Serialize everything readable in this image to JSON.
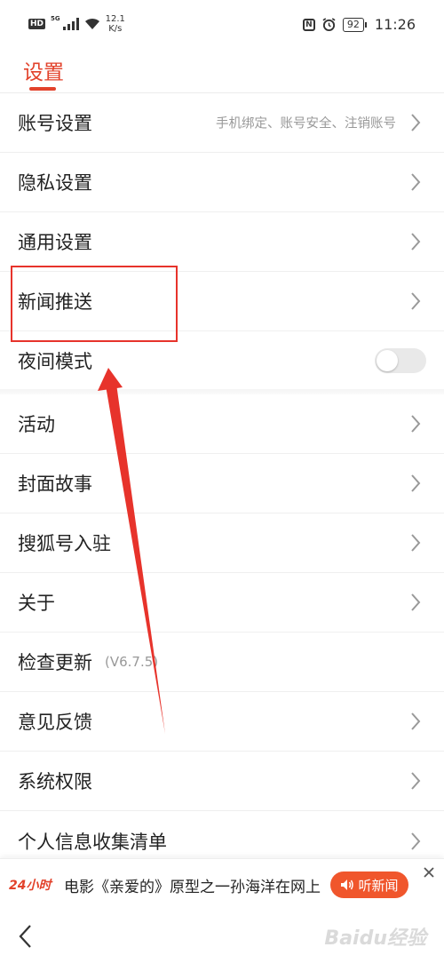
{
  "status_bar": {
    "hd": "HD",
    "network": "5G",
    "speed_value": "12.1",
    "speed_unit": "K/s",
    "nfc": "N",
    "battery": "92",
    "time": "11:26"
  },
  "header": {
    "title": "设置"
  },
  "settings": [
    {
      "label": "账号设置",
      "sub": "手机绑定、账号安全、注销账号",
      "control": "chevron"
    },
    {
      "label": "隐私设置",
      "control": "chevron"
    },
    {
      "label": "通用设置",
      "control": "chevron"
    },
    {
      "label": "新闻推送",
      "control": "chevron"
    },
    {
      "label": "夜间模式",
      "control": "toggle",
      "toggle_on": false
    },
    {
      "label": "活动",
      "control": "chevron"
    },
    {
      "label": "封面故事",
      "control": "chevron"
    },
    {
      "label": "搜狐号入驻",
      "control": "chevron"
    },
    {
      "label": "关于",
      "control": "chevron"
    },
    {
      "label": "检查更新",
      "version": "(V6.7.5)",
      "control": "none"
    },
    {
      "label": "意见反馈",
      "control": "chevron"
    },
    {
      "label": "系统权限",
      "control": "chevron"
    },
    {
      "label": "个人信息收集清单",
      "control": "chevron"
    }
  ],
  "news_bar": {
    "badge": "24小时",
    "headline": "电影《亲爱的》原型之一孙海洋在网上",
    "listen_label": "听新闻"
  },
  "watermark": "Baidu经验",
  "colors": {
    "accent": "#e2422b",
    "annotation": "#e7332b",
    "listen_button": "#f0562c"
  }
}
